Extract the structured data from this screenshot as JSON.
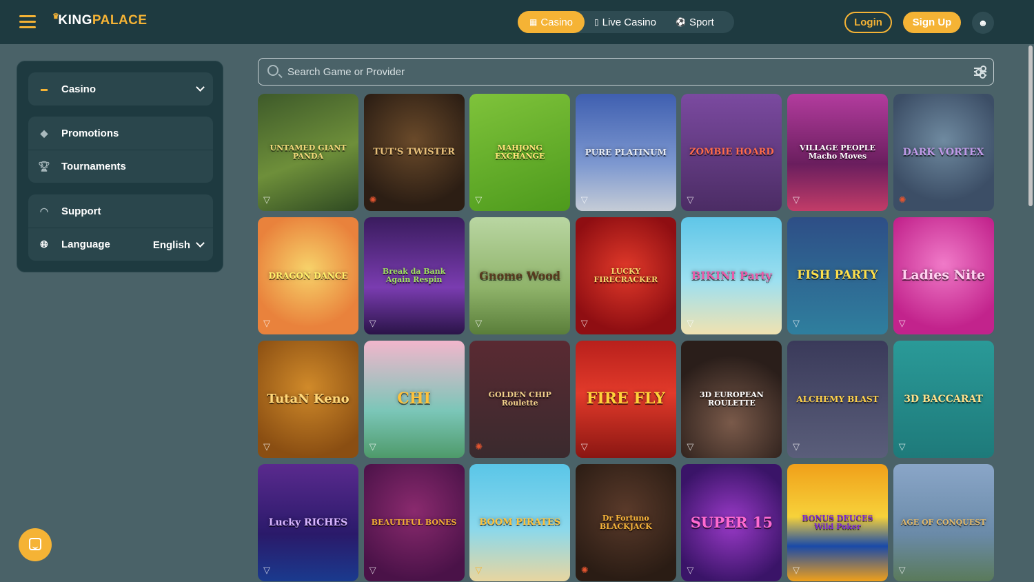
{
  "header": {
    "logo_king": "KING",
    "logo_palace": "PALACE",
    "tabs": [
      {
        "label": "Casino",
        "icon": "slot-777-icon"
      },
      {
        "label": "Live Casino",
        "icon": "card-icon"
      },
      {
        "label": "Sport",
        "icon": "soccer-ball-icon"
      }
    ],
    "login_label": "Login",
    "signup_label": "Sign Up"
  },
  "sidebar": {
    "casino_label": "Casino",
    "promotions_label": "Promotions",
    "tournaments_label": "Tournaments",
    "support_label": "Support",
    "language_label": "Language",
    "language_value": "English"
  },
  "search": {
    "placeholder": "Search Game or Provider"
  },
  "colors": {
    "accent": "#f5b335",
    "header_bg": "#1e3a40",
    "page_bg": "#4a6268"
  },
  "games": [
    {
      "title": "UNTAMED GIANT PANDA",
      "bg": "linear-gradient(160deg,#3e5a2a,#6e8f3a 55%,#2f4a22)",
      "color": "#f0d77a",
      "provider": "triangle"
    },
    {
      "title": "TUT'S TWISTER",
      "bg": "radial-gradient(circle at 50% 40%,#6a4a2a,#2c1e14 75%)",
      "color": "#e8c07a",
      "provider": "red"
    },
    {
      "title": "MAHJONG EXCHANGE",
      "bg": "linear-gradient(160deg,#7fc33b,#4d9a1c)",
      "color": "#ffe37a",
      "provider": "triangle"
    },
    {
      "title": "PURE PLATINUM",
      "bg": "linear-gradient(180deg,#3f5fb0,#7d98d0 60%,#c5ccd6)",
      "color": "#e6eaf2",
      "provider": "triangle"
    },
    {
      "title": "ZOMBIE HOARD",
      "bg": "linear-gradient(180deg,#7b4aa0,#4b2c64)",
      "color": "#ff6b4a",
      "provider": "triangle"
    },
    {
      "title": "VILLAGE PEOPLE Macho Moves",
      "bg": "linear-gradient(180deg,#b33c9e,#6a1e5e 60%,#c23c68)",
      "color": "#ffffff",
      "provider": "triangle"
    },
    {
      "title": "DARK VORTEX",
      "bg": "radial-gradient(circle at 50% 40%,#6f8aa0,#3c4e66 70%)",
      "color": "#c09ae8",
      "provider": "red"
    },
    {
      "title": "DRAGON DANCE",
      "bg": "radial-gradient(circle at 50% 45%,#f7d36a,#e9823c 70%)",
      "color": "#ffef6a",
      "provider": "triangle"
    },
    {
      "title": "Break da Bank Again Respin",
      "bg": "linear-gradient(180deg,#3a1c5e,#7a3cb0 60%,#2a1448)",
      "color": "#a0e060",
      "provider": "triangle"
    },
    {
      "title": "Gnome Wood",
      "bg": "linear-gradient(180deg,#b9d6a2,#8fb36a 60%,#5a7e3a)",
      "color": "#5a3a1e",
      "provider": "triangle"
    },
    {
      "title": "LUCKY FIRECRACKER",
      "bg": "radial-gradient(circle at 50% 45%,#e23a2a,#8f0e12 75%)",
      "color": "#f7d46a",
      "provider": "triangle"
    },
    {
      "title": "BIKINI Party",
      "bg": "linear-gradient(180deg,#5fc6e8,#9ee0f0 55%,#f0e2b0)",
      "color": "#e85aa8",
      "provider": "triangle"
    },
    {
      "title": "FISH PARTY",
      "bg": "linear-gradient(180deg,#2e4e86,#2f7f9e)",
      "color": "#ffe04a",
      "provider": "triangle"
    },
    {
      "title": "Ladies Nite",
      "bg": "radial-gradient(circle at 50% 40%,#f07ac8,#c2238c 75%)",
      "color": "#ffd2f0",
      "provider": "triangle"
    },
    {
      "title": "TutaN Keno",
      "bg": "radial-gradient(circle at 50% 40%,#d08a2a,#8a4e12 80%)",
      "color": "#ffd87a",
      "provider": "triangle"
    },
    {
      "title": "CHI",
      "bg": "linear-gradient(180deg,#f2b6cc,#7bc6b8 60%,#4e9a6a)",
      "color": "#ffc23a",
      "provider": "triangle"
    },
    {
      "title": "GOLDEN CHIP Roulette",
      "bg": "linear-gradient(180deg,#5a2a32,#3a2a2e)",
      "color": "#f0d08a",
      "provider": "red"
    },
    {
      "title": "FIRE FLY",
      "bg": "linear-gradient(180deg,#b8201c,#e23a2a 45%,#8a1612)",
      "color": "#ffd23a",
      "provider": "triangle"
    },
    {
      "title": "3D EUROPEAN ROULETTE",
      "bg": "radial-gradient(circle at 50% 70%,#7a5a4a,#2a1e1a 70%)",
      "color": "#ffffff",
      "provider": "triangle"
    },
    {
      "title": "ALCHEMY BLAST",
      "bg": "linear-gradient(180deg,#3a3a5a,#5a5e7a)",
      "color": "#ffd24a",
      "provider": "triangle"
    },
    {
      "title": "3D BACCARAT",
      "bg": "linear-gradient(180deg,#2a9a98,#1e7a7a)",
      "color": "#ffe08a",
      "provider": "triangle"
    },
    {
      "title": "Lucky RICHES",
      "bg": "linear-gradient(180deg,#5a2a8e,#2a1a6a 60%,#1a3a8e)",
      "color": "#d8b6ff",
      "provider": "triangle"
    },
    {
      "title": "BEAUTIFUL BONES",
      "bg": "radial-gradient(circle at 50% 40%,#8a2a6e,#4a1248 80%)",
      "color": "#f5b035",
      "provider": "triangle"
    },
    {
      "title": "BOOM PIRATES",
      "bg": "linear-gradient(180deg,#5ac6e8,#8ad8ec 55%,#e8d6a0)",
      "color": "#ffc23a",
      "provider": "yellow"
    },
    {
      "title": "Dr Fortuno BLACKJACK",
      "bg": "radial-gradient(circle at 50% 40%,#5a3a2a,#2a1c14 80%)",
      "color": "#f7b53a",
      "provider": "red"
    },
    {
      "title": "SUPER 15",
      "bg": "radial-gradient(circle at 50% 50%,#9a3ac8,#3a1468 80%)",
      "color": "#ff6ad0",
      "provider": "triangle"
    },
    {
      "title": "BONUS DEUCES Wild Poker",
      "bg": "linear-gradient(180deg,#f0a01a,#f7d23a 45%,#1a4aa8 70%,#f0a01a)",
      "color": "#7a2ad0",
      "provider": "triangle"
    },
    {
      "title": "AGE OF CONQUEST",
      "bg": "linear-gradient(180deg,#8aa6c8,#6a8aa8 60%,#5a7a5a)",
      "color": "#e0b86a",
      "provider": "triangle"
    }
  ]
}
